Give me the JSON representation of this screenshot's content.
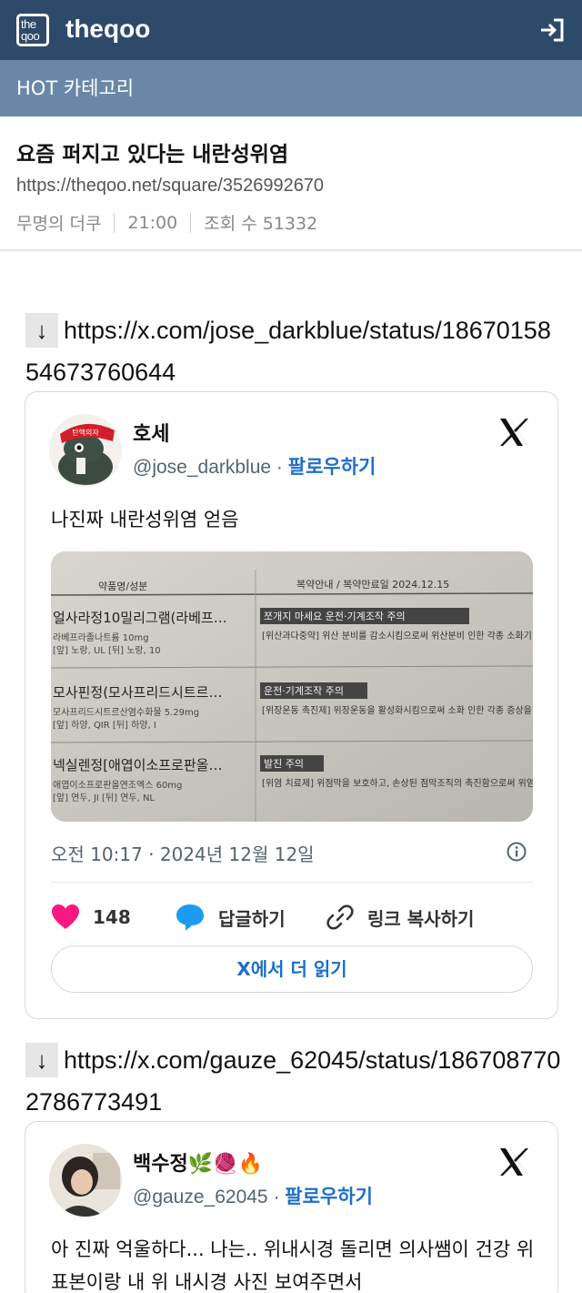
{
  "header": {
    "logo_text": "the qoo",
    "brand": "theqoo",
    "icon": "login-icon"
  },
  "category": {
    "label": "HOT 카테고리"
  },
  "post": {
    "title": "요즘 퍼지고 있다는 내란성위염",
    "url": "https://theqoo.net/square/3526992670",
    "author": "무명의 더쿠",
    "time": "21:00",
    "views": "조회 수 51332"
  },
  "embeds": [
    {
      "arrow": "↓",
      "link": "https://x.com/jose_darkblue/status/1867015854673760644",
      "tweet": {
        "name": "호세",
        "handle": "@jose_darkblue",
        "follow": "팔로우하기",
        "text": "나진짜 내란성위염 얻음",
        "photo": {
          "header_left": "약품명/성분",
          "header_right": "복약안내 / 복약만료일 2024.12.15",
          "rows": [
            {
              "name": "얼사라정10밀리그램(라베프…",
              "sub": "라베프라졸나트륨 10mg",
              "sub2": "[앞] 노랑, UL [뒤] 노랑, 10",
              "tag": "쪼개지 마세요 운전·기계조작 주의",
              "desc": "[위산과다중약] 위산 분비를 감소시킴으로써 위산분비 인한 각종 소화기 증상을 개선하는 약입니다."
            },
            {
              "name": "모사핀정(모사프리드시트르…",
              "sub": "모사프리드시트르산염수화물 5.29mg",
              "sub2": "[앞] 하양, QIR [뒤] 하양, I",
              "tag": "운전·기계조작 주의",
              "desc": "[위장운동 촉진제] 위장운동을 활성화시킴으로써 소화 인한 각종 증상을 개선하는 약입니다."
            },
            {
              "name": "넥실렌정[애엽이소프로판올…",
              "sub": "애엽이소프로판올연조엑스 60mg",
              "sub2": "[앞] 연두, JI [뒤] 연두, NL",
              "tag": "발진 주의",
              "desc": "[위염 치료제] 위점막을 보호하고, 손상된 점막조직의 촉진함으로써 위염을 예방 및 치료하는 약입니다."
            }
          ]
        },
        "time": "오전 10:17 · 2024년 12월 12일",
        "likes": "148",
        "reply": "답글하기",
        "copy": "링크 복사하기",
        "read_more": "X에서 더 읽기"
      }
    },
    {
      "arrow": "↓",
      "link": "https://x.com/gauze_62045/status/1867087702786773491",
      "tweet": {
        "name": "백수정🌿🧶🔥",
        "handle": "@gauze_62045",
        "follow": "팔로우하기",
        "text": "아 진짜 억울하다... 나는.. 위내시경 돌리면 의사쌤이 건강 위 표본이랑 내 위 내시경 사진 보여주면서"
      }
    }
  ],
  "colors": {
    "topbar": "#2e4a6b",
    "catbar": "#6a87a8",
    "link_blue": "#1d6fc8",
    "heart": "#f91880",
    "reply_blue": "#1d9bf0"
  }
}
